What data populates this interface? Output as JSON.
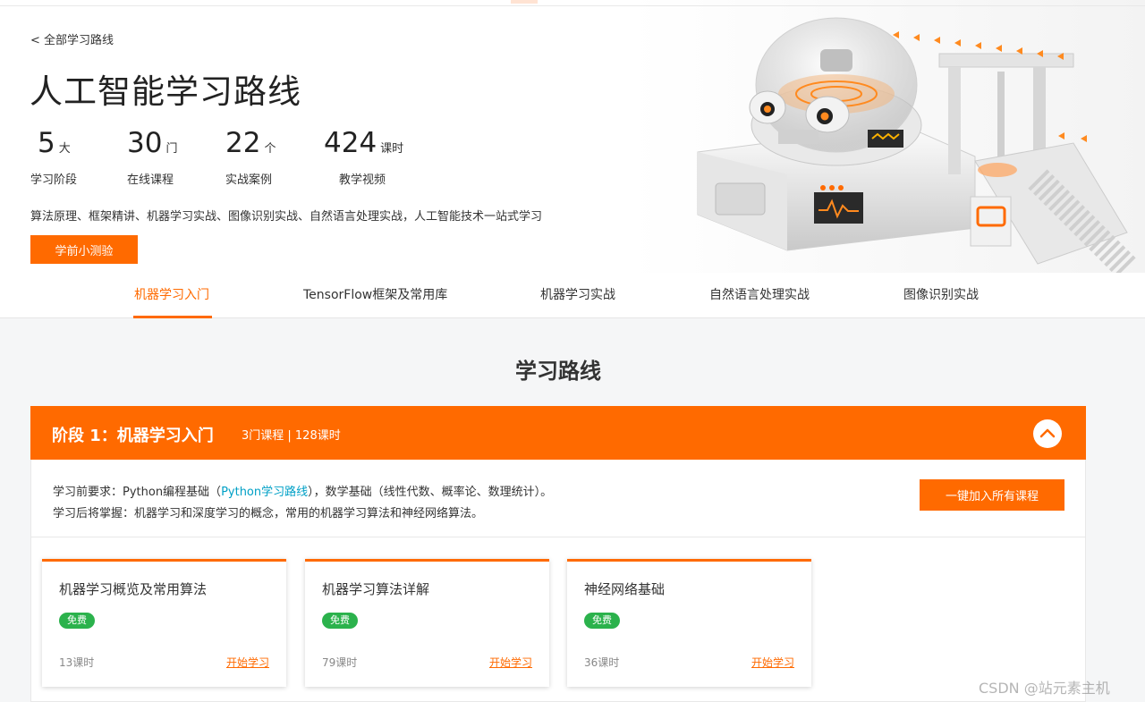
{
  "hero": {
    "back_link": "< 全部学习路线",
    "title": "人工智能学习路线",
    "stats": [
      {
        "num": "5",
        "unit": "大",
        "label": "学习阶段"
      },
      {
        "num": "30",
        "unit": "门",
        "label": "在线课程"
      },
      {
        "num": "22",
        "unit": "个",
        "label": "实战案例"
      },
      {
        "num": "424",
        "unit": "课时",
        "label": "教学视频"
      }
    ],
    "description": "算法原理、框架精讲、机器学习实战、图像识别实战、自然语言处理实战，人工智能技术一站式学习",
    "quiz_button": "学前小测验"
  },
  "tabs": [
    {
      "label": "机器学习入门",
      "active": true
    },
    {
      "label": "TensorFlow框架及常用库",
      "active": false
    },
    {
      "label": "机器学习实战",
      "active": false
    },
    {
      "label": "自然语言处理实战",
      "active": false
    },
    {
      "label": "图像识别实战",
      "active": false
    }
  ],
  "section_title": "学习路线",
  "stage": {
    "name": "阶段 1：机器学习入门",
    "meta": "3门课程 | 128课时",
    "prereq_prefix": "学习前要求：Python编程基础（",
    "prereq_link": "Python学习路线",
    "prereq_suffix": "），数学基础（线性代数、概率论、数理统计）。",
    "outcome": "学习后将掌握：机器学习和深度学习的概念，常用的机器学习算法和神经网络算法。",
    "join_button": "一键加入所有课程",
    "courses": [
      {
        "title": "机器学习概览及常用算法",
        "badge": "免费",
        "hours": "13课时",
        "action": "开始学习"
      },
      {
        "title": "机器学习算法详解",
        "badge": "免费",
        "hours": "79课时",
        "action": "开始学习"
      },
      {
        "title": "神经网络基础",
        "badge": "免费",
        "hours": "36课时",
        "action": "开始学习"
      }
    ]
  },
  "watermark": "CSDN @站元素主机",
  "colors": {
    "accent": "#ff6a00",
    "free_badge": "#2bb24c",
    "link": "#00a0c6"
  }
}
